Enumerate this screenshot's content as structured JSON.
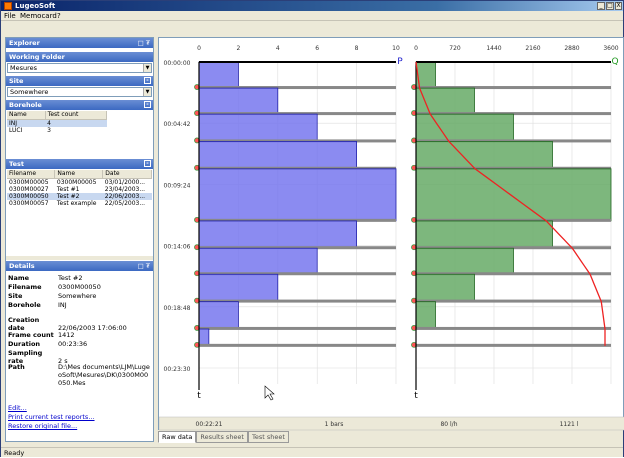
{
  "window": {
    "title": "LugeoSoft",
    "min": "_",
    "max": "□",
    "close": "X"
  },
  "menu": {
    "items": [
      "File",
      "Memocard",
      "?"
    ]
  },
  "explorer": {
    "title": "Explorer",
    "pin": "□ ₮",
    "working_folder": {
      "title": "Working Folder",
      "value": "Mesures"
    },
    "site": {
      "title": "Site",
      "value": "Somewhere"
    },
    "borehole": {
      "title": "Borehole",
      "columns": [
        "Name",
        "Test count"
      ],
      "rows": [
        [
          "INJ",
          "4"
        ],
        [
          "LUCI",
          "3"
        ]
      ]
    },
    "test": {
      "title": "Test",
      "columns": [
        "Filename",
        "Name",
        "Date"
      ],
      "rows": [
        [
          "0300M00005",
          "0300M00005",
          "03/01/2000..."
        ],
        [
          "0300M00027",
          "Test #1",
          "23/04/2003..."
        ],
        [
          "0300M00050",
          "Test #2",
          "22/06/2003..."
        ],
        [
          "0300M00057",
          "Test example",
          "22/05/2003..."
        ]
      ],
      "selected_row": 2
    }
  },
  "details": {
    "title": "Details",
    "pin": "□ ₮",
    "fields": [
      {
        "k": "Name",
        "v": "Test #2"
      },
      {
        "k": "Filename",
        "v": "0300M00050"
      },
      {
        "k": "Site",
        "v": "Somewhere"
      },
      {
        "k": "Borehole",
        "v": "INJ"
      },
      {
        "k": "Creation date",
        "v": "22/06/2003 17:06:00"
      },
      {
        "k": "Frame count",
        "v": "1412"
      },
      {
        "k": "Duration",
        "v": "00:23:36"
      },
      {
        "k": "Sampling rate",
        "v": "2 s"
      },
      {
        "k": "Path",
        "v": "D:\\Mes documents\\LJM\\LugeoSoft\\Mesures\\DK\\0300M00050.Mes"
      }
    ],
    "links": [
      "Edit...",
      "Print current test reports...",
      "Restore original file..."
    ]
  },
  "chart_data": [
    {
      "type": "bar",
      "orientation": "horizontal",
      "series_label": "P",
      "color": "#7777ee",
      "xlim": [
        0,
        10
      ],
      "xticks": [
        "0",
        "2",
        "4",
        "6",
        "8",
        "10"
      ],
      "time_ticks": [
        "00:00:00",
        "00:04:42",
        "00:09:24",
        "00:14:06",
        "00:18:48",
        "00:23:30"
      ],
      "steps": [
        {
          "from_min": 0,
          "to_min": 2.0,
          "value": 2.0
        },
        {
          "from_min": 2.0,
          "to_min": 4.0,
          "value": 4.0
        },
        {
          "from_min": 4.0,
          "to_min": 6.1,
          "value": 6.0
        },
        {
          "from_min": 6.1,
          "to_min": 8.2,
          "value": 8.0
        },
        {
          "from_min": 8.2,
          "to_min": 12.2,
          "value": 10.0
        },
        {
          "from_min": 12.2,
          "to_min": 14.3,
          "value": 8.0
        },
        {
          "from_min": 14.3,
          "to_min": 16.3,
          "value": 6.0
        },
        {
          "from_min": 16.3,
          "to_min": 18.4,
          "value": 4.0
        },
        {
          "from_min": 18.4,
          "to_min": 20.5,
          "value": 2.0
        },
        {
          "from_min": 20.5,
          "to_min": 21.8,
          "value": 0.5
        }
      ],
      "axis_label": "t"
    },
    {
      "type": "bar",
      "orientation": "horizontal",
      "series_label": "Q",
      "color": "#66aa66",
      "xlim": [
        0,
        3600
      ],
      "xticks": [
        "0",
        "720",
        "1440",
        "2160",
        "2880",
        "3600"
      ],
      "steps": [
        {
          "from_min": 0,
          "to_min": 2.0,
          "value": 360
        },
        {
          "from_min": 2.0,
          "to_min": 4.0,
          "value": 1080
        },
        {
          "from_min": 4.0,
          "to_min": 6.1,
          "value": 1800
        },
        {
          "from_min": 6.1,
          "to_min": 8.2,
          "value": 2520
        },
        {
          "from_min": 8.2,
          "to_min": 12.2,
          "value": 3600
        },
        {
          "from_min": 12.2,
          "to_min": 14.3,
          "value": 2520
        },
        {
          "from_min": 14.3,
          "to_min": 16.3,
          "value": 1800
        },
        {
          "from_min": 16.3,
          "to_min": 18.4,
          "value": 1080
        },
        {
          "from_min": 18.4,
          "to_min": 20.5,
          "value": 360
        },
        {
          "from_min": 20.5,
          "to_min": 21.8,
          "value": 0
        }
      ],
      "cumulative_line_color": "#ee2222",
      "axis_label": "t"
    }
  ],
  "readout": {
    "time": "00:22:21",
    "p": "1 bars",
    "q": "80 l/h",
    "vol": "1121 l"
  },
  "tabs": [
    "Raw data",
    "Results sheet",
    "Test sheet"
  ],
  "active_tab": 0,
  "status": "Ready"
}
